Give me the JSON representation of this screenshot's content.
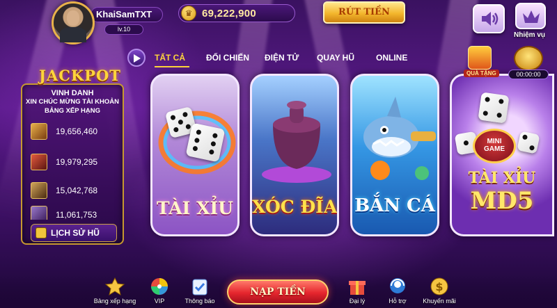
{
  "player": {
    "name": "KhaiSamTXT",
    "level": "lv.10",
    "coins": "69,222,900"
  },
  "header": {
    "withdraw_label": "RÚT TIỀN",
    "mission_label": "Nhiệm vụ",
    "sound_icon": "speaker-icon",
    "mission_icon": "crown-icon"
  },
  "tabs": [
    {
      "label": "TẤT CẢ",
      "active": true
    },
    {
      "label": "ĐỐI CHIẾN",
      "active": false
    },
    {
      "label": "ĐIỆN TỬ",
      "active": false
    },
    {
      "label": "QUAY HŨ",
      "active": false
    },
    {
      "label": "ONLINE",
      "active": false
    }
  ],
  "jackpot": {
    "title": "JACKPOT",
    "subtitle": "VINH DANH",
    "congrats": "XIN CHÚC MỪNG TÀI KHOẢN",
    "ranking": "BẢNG XẾP HẠNG",
    "entries": [
      {
        "amount": "19,656,460",
        "color": "#c9872a"
      },
      {
        "amount": "19,979,295",
        "color": "#b8352c"
      },
      {
        "amount": "15,042,768",
        "color": "#9a6a2a"
      },
      {
        "amount": "11,061,753",
        "color": "#6a4a8a"
      }
    ],
    "history_label": "LỊCH SỬ HŨ"
  },
  "games": [
    {
      "label": "TÀI XỈU"
    },
    {
      "label": "XÓC ĐĨA"
    },
    {
      "label": "BẮN CÁ"
    },
    {
      "label_line1": "TÀI XỈU",
      "label_line2": "MD5",
      "badge_line1": "MINI",
      "badge_line2": "GAME"
    }
  ],
  "side": {
    "gift_label": "QUÀ TẶNG",
    "timer": "00:00:00"
  },
  "bottom": {
    "items": [
      {
        "label": "Bảng xếp hạng",
        "icon": "trophy-icon"
      },
      {
        "label": "VIP",
        "icon": "vip-wheel-icon"
      },
      {
        "label": "Thông báo",
        "icon": "notification-icon"
      },
      {
        "label": "Đại lý",
        "icon": "gift-box-icon"
      },
      {
        "label": "Hỗ trợ",
        "icon": "support-icon"
      },
      {
        "label": "Khuyến mãi",
        "icon": "dollar-coin-icon"
      }
    ],
    "topup_label": "NẠP TIỀN"
  },
  "colors": {
    "accent_gold": "#ffd43b",
    "panel_purple": "#3b0f62",
    "topup_red": "#e5252d"
  }
}
